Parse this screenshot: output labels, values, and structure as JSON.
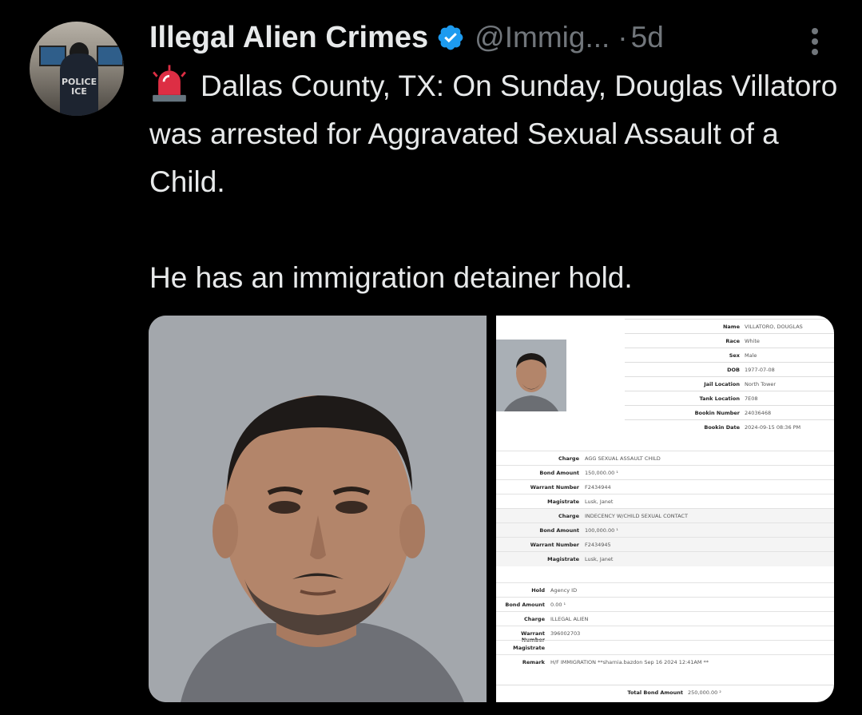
{
  "post": {
    "display_name": "Illegal Alien Crimes",
    "handle": "@Immig...",
    "separator": "·",
    "time": "5d",
    "avatar_text": "POLICE ICE",
    "paragraph1": "Dallas County, TX: On Sunday, Douglas Villatoro was arrested for Aggravated Sexual Assault of a Child.",
    "paragraph2": "He has an immigration detainer hold."
  },
  "icons": {
    "verified": "verified-badge-icon",
    "siren": "police-siren-emoji",
    "more": "more-options-icon"
  },
  "colors": {
    "background": "#000000",
    "text": "#e7e9ea",
    "muted": "#71767b",
    "verified_blue": "#1d9bf0"
  },
  "record": {
    "info": [
      {
        "label": "Name",
        "value": "VILLATORO, DOUGLAS"
      },
      {
        "label": "Race",
        "value": "White"
      },
      {
        "label": "Sex",
        "value": "Male"
      },
      {
        "label": "DOB",
        "value": "1977-07-08"
      },
      {
        "label": "Jail Location",
        "value": "North Tower"
      },
      {
        "label": "Tank Location",
        "value": "7E08"
      },
      {
        "label": "Bookin Number",
        "value": "24036468"
      },
      {
        "label": "Bookin Date",
        "value": "2024-09-15 08:36 PM"
      }
    ],
    "charges": [
      {
        "label": "Charge",
        "value": "AGG SEXUAL ASSAULT CHILD"
      },
      {
        "label": "Bond Amount",
        "value": "150,000.00 ¹"
      },
      {
        "label": "Warrant Number",
        "value": "F2434944"
      },
      {
        "label": "Magistrate",
        "value": "Lusk, Janet"
      },
      {
        "label": "Charge",
        "value": "INDECENCY W/CHILD SEXUAL CONTACT"
      },
      {
        "label": "Bond Amount",
        "value": "100,000.00 ¹"
      },
      {
        "label": "Warrant Number",
        "value": "F2434945"
      },
      {
        "label": "Magistrate",
        "value": "Lusk, Janet"
      }
    ],
    "holds": [
      {
        "label": "Hold",
        "value": "Agency ID"
      },
      {
        "label": "Bond Amount",
        "value": "0.00 ¹"
      },
      {
        "label": "Charge",
        "value": "ILLEGAL ALIEN"
      },
      {
        "label": "Warrant Number",
        "value": "396002703"
      },
      {
        "label": "Magistrate",
        "value": ""
      },
      {
        "label": "Remark",
        "value": "H/F IMMIGRATION **sharnia.bazdon Sep 16 2024 12:41AM **"
      }
    ],
    "total": {
      "label": "Total Bond Amount",
      "value": "250,000.00 ²"
    }
  }
}
